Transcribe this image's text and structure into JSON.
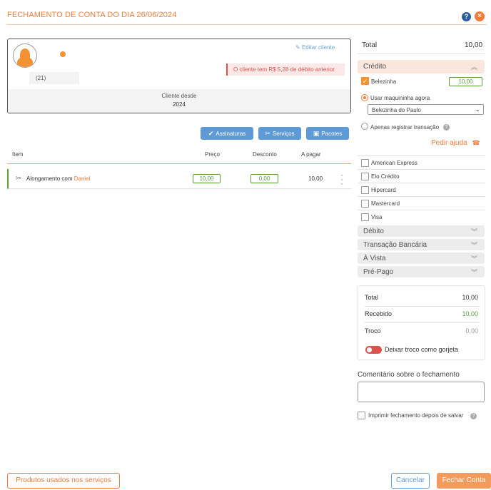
{
  "header": {
    "title": "FECHAMENTO DE CONTA DO DIA 26/06/2024",
    "help_label": "?",
    "close_label": "×"
  },
  "client": {
    "phone": "(21)",
    "edit_label": "Editar cliente",
    "debt_alert": "O cliente tem R$ 5,28 de débito anterior",
    "since_label": "Cliente desde",
    "since_value": "2024"
  },
  "actions": {
    "subscriptions_label": "Assinaturas",
    "services_label": "Serviços",
    "packages_label": "Pacotes"
  },
  "table": {
    "headers": [
      "Item",
      "Preço",
      "Desconto",
      "A pagar"
    ],
    "rows": [
      {
        "label": "Alongamento com",
        "professional": "Daniel",
        "price": "10,00",
        "discount": "0,00",
        "total": "10,00"
      }
    ]
  },
  "payment": {
    "total_label": "Total",
    "total_value": "10,00",
    "credit_label": "Crédito",
    "belezinha_label": "Belezinha",
    "belezinha_value": "10,00",
    "use_machine_label": "Usar maquininha agora",
    "machine_selected": "Belezinha do Paulo",
    "register_only_label": "Apenas registrar transação",
    "help_link": "Pedir ajuda",
    "brands": [
      "American Express",
      "Elo Crédito",
      "Hipercard",
      "Mastercard",
      "Visa"
    ],
    "sections": [
      "Débito",
      "Transação Bancária",
      "À Vista",
      "Pré-Pago"
    ]
  },
  "summary": {
    "total_label": "Total",
    "total_value": "10,00",
    "received_label": "Recebido",
    "received_value": "10,00",
    "change_label": "Troco",
    "change_value": "0,00",
    "tip_toggle_label": "Deixar troco como gorjeta"
  },
  "comment": {
    "label": "Comentário sobre o fechamento",
    "print_label": "Imprimir fechamento depois de salvar"
  },
  "footer": {
    "products_label": "Produtos usados nos serviços",
    "cancel_label": "Cancelar",
    "close_account_label": "Fechar Conta"
  },
  "colors": {
    "accent": "#f07c3a",
    "blue": "#5d9ad6",
    "green": "#5a9e3c",
    "danger": "#d9534f"
  }
}
